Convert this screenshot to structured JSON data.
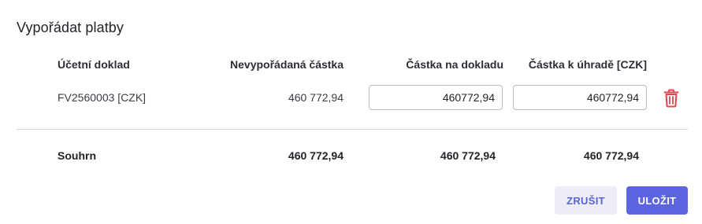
{
  "dialog": {
    "title": "Vypořádat platby"
  },
  "table": {
    "columns": [
      "Účetní doklad",
      "Nevypořádaná částka",
      "Částka na dokladu",
      "Částka k úhradě [CZK]"
    ],
    "rows": [
      {
        "document": "FV2560003 [CZK]",
        "unsettled_amount": "460 772,94",
        "document_amount": "460772,94",
        "payment_amount": "460772,94"
      }
    ],
    "delete_icon": "trash-icon",
    "delete_color": "#e0464e"
  },
  "summary": {
    "label": "Souhrn",
    "unsettled_amount": "460 772,94",
    "document_amount": "460 772,94",
    "payment_amount": "460 772,94"
  },
  "actions": {
    "cancel_label": "ZRUŠIT",
    "save_label": "ULOŽIT"
  },
  "colors": {
    "primary": "#5c64e0",
    "secondary_bg": "#ecedf6",
    "danger": "#e0464e"
  }
}
